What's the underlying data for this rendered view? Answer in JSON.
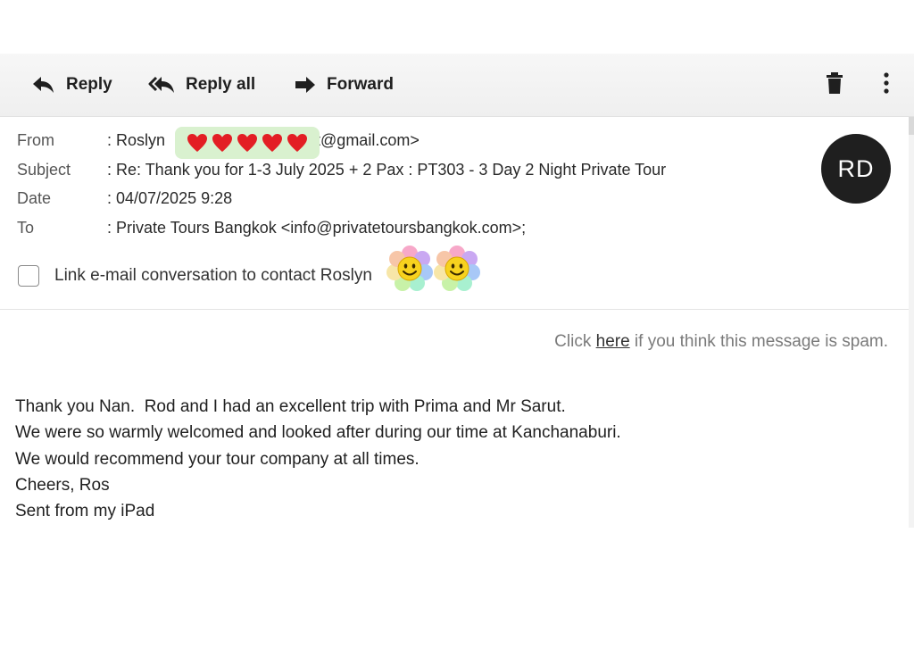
{
  "toolbar": {
    "reply_label": "Reply",
    "reply_all_label": "Reply all",
    "forward_label": "Forward",
    "icons": [
      "reply-icon",
      "reply-all-icon",
      "forward-icon",
      "trash-icon",
      "more-vert-icon"
    ]
  },
  "header": {
    "from_label": "From",
    "from_value_prefix": ": Roslyn ",
    "from_value_suffix": "t@gmail.com>",
    "subject_label": "Subject",
    "subject_value": ": Re: Thank you for 1-3 July 2025 + 2 Pax : PT303 - 3 Day 2 Night Private Tour",
    "date_label": "Date",
    "date_value": ": 04/07/2025 9:28",
    "to_label": "To",
    "to_value": ": Private Tours Bangkok <info@privatetoursbangkok.com>;",
    "avatar_initials": "RD",
    "avatar_color": "#1f1f1f",
    "redaction_color": "#d9f1cf",
    "link_contact_text": "Link e-mail conversation to contact Roslyn ",
    "link_contact_checked": false
  },
  "spam": {
    "prefix": "Click ",
    "link": "here",
    "suffix": " if you think this message is spam."
  },
  "message": {
    "lines": [
      "Thank you Nan.  Rod and I had an excellent trip with Prima and Mr Sarut.",
      "We were so warmly welcomed and looked after during our time at Kanchanaburi.",
      "We would recommend your tour company at all times.",
      "Cheers, Ros",
      "Sent from my iPad"
    ]
  }
}
